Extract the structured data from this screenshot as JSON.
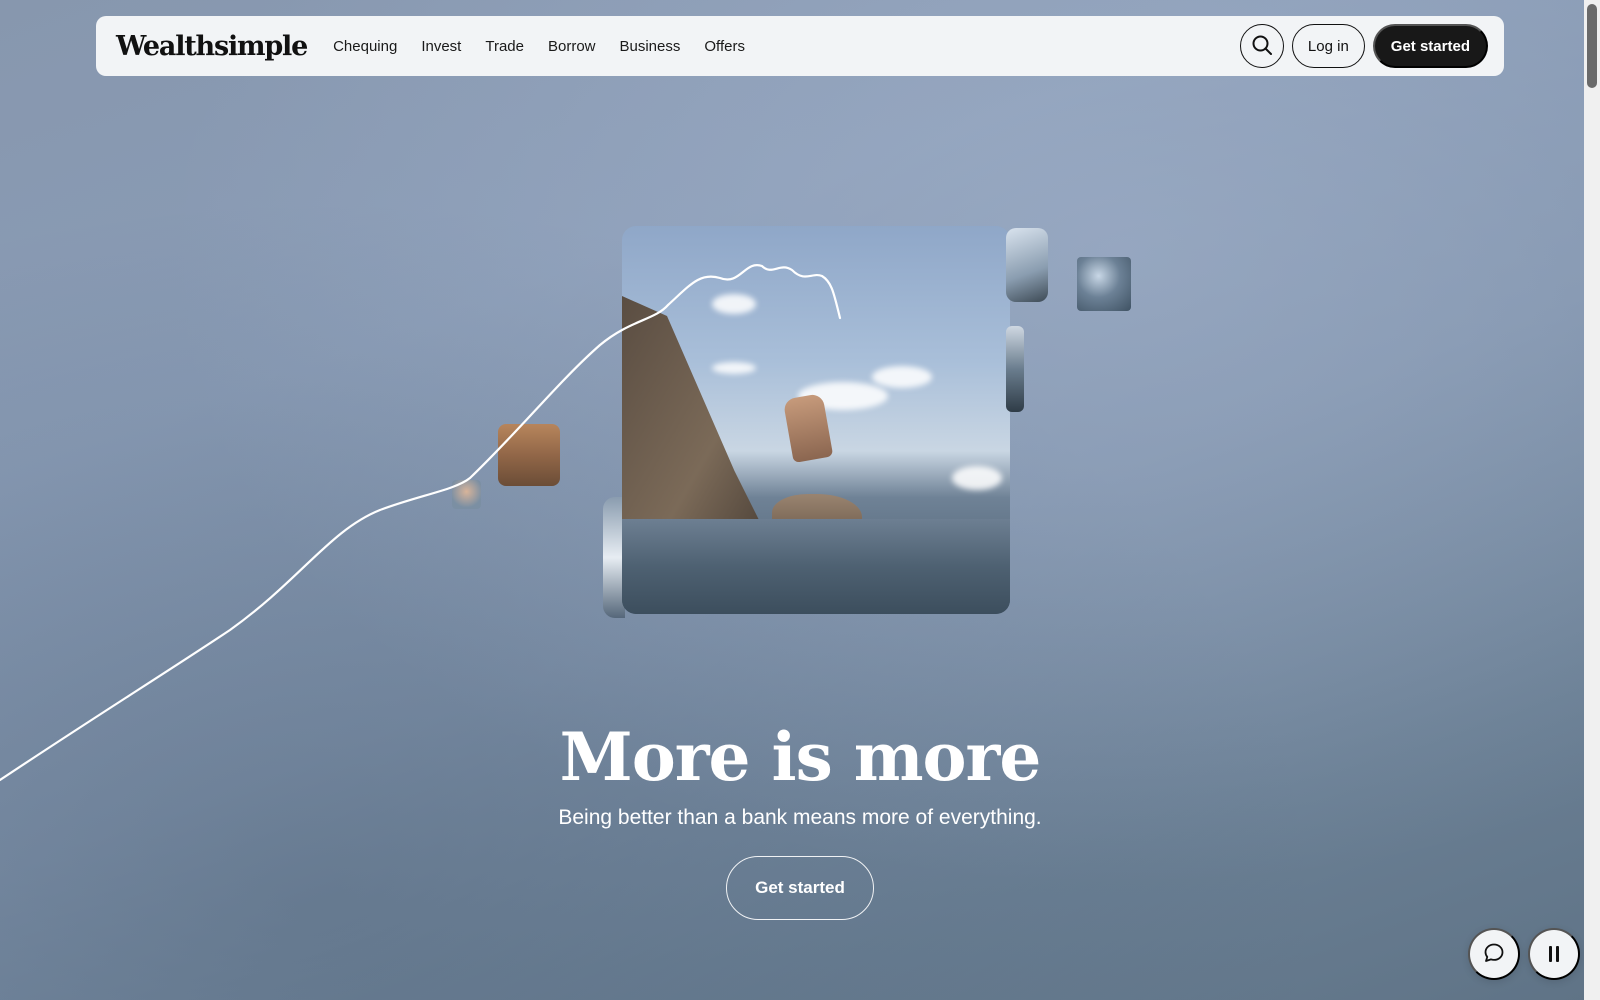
{
  "header": {
    "logo": "Wealthsimple",
    "nav_links": [
      {
        "label": "Chequing"
      },
      {
        "label": "Invest"
      },
      {
        "label": "Trade"
      },
      {
        "label": "Borrow"
      },
      {
        "label": "Business"
      },
      {
        "label": "Offers"
      }
    ],
    "search_icon": "search-icon",
    "login_label": "Log in",
    "get_started_label": "Get started"
  },
  "hero": {
    "title": "More is more",
    "subtitle": "Being better than a bank means more of everything.",
    "cta_label": "Get started"
  },
  "floating_controls": {
    "chat_icon": "chat-bubble-icon",
    "pause_icon": "pause-icon"
  },
  "colors": {
    "primary_dark": "#181818",
    "nav_bg": "#f2f4f6",
    "hero_text": "#ffffff"
  }
}
